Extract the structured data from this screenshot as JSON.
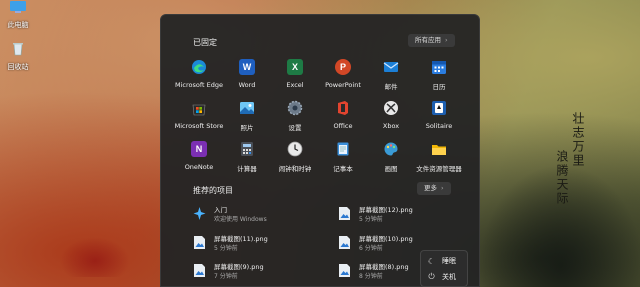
{
  "desktop": {
    "icons": [
      {
        "label": "此电脑",
        "icon": "computer-icon"
      },
      {
        "label": "回收站",
        "icon": "recycle-bin-icon"
      }
    ]
  },
  "wallpaper": {
    "poem_columns": [
      "壮",
      "志",
      "万",
      "里",
      "浪",
      "腾",
      "天",
      "际"
    ]
  },
  "start": {
    "pinned_title": "已固定",
    "all_apps_label": "所有应用",
    "pinned_apps": [
      {
        "label": "Microsoft Edge",
        "icon": "edge-icon"
      },
      {
        "label": "Word",
        "icon": "word-icon"
      },
      {
        "label": "Excel",
        "icon": "excel-icon"
      },
      {
        "label": "PowerPoint",
        "icon": "powerpoint-icon"
      },
      {
        "label": "邮件",
        "icon": "mail-icon"
      },
      {
        "label": "日历",
        "icon": "calendar-icon"
      },
      {
        "label": "Microsoft Store",
        "icon": "store-icon"
      },
      {
        "label": "照片",
        "icon": "photos-icon"
      },
      {
        "label": "设置",
        "icon": "settings-icon"
      },
      {
        "label": "Office",
        "icon": "office-icon"
      },
      {
        "label": "Xbox",
        "icon": "xbox-icon"
      },
      {
        "label": "Solitaire",
        "icon": "solitaire-icon"
      },
      {
        "label": "OneNote",
        "icon": "onenote-icon"
      },
      {
        "label": "计算器",
        "icon": "calculator-icon"
      },
      {
        "label": "闹钟和时钟",
        "icon": "clock-icon"
      },
      {
        "label": "记事本",
        "icon": "notepad-icon"
      },
      {
        "label": "画图",
        "icon": "paint-icon"
      },
      {
        "label": "文件资源管理器",
        "icon": "file-explorer-icon"
      }
    ],
    "recommended_title": "推荐的项目",
    "more_label": "更多",
    "recommended": [
      {
        "title": "入门",
        "subtitle": "欢迎使用 Windows",
        "icon": "get-started-icon"
      },
      {
        "title": "屏幕截图(12).png",
        "subtitle": "5 分钟前",
        "icon": "image-file-icon"
      },
      {
        "title": "屏幕截图(11).png",
        "subtitle": "5 分钟前",
        "icon": "image-file-icon"
      },
      {
        "title": "屏幕截图(10).png",
        "subtitle": "6 分钟前",
        "icon": "image-file-icon"
      },
      {
        "title": "屏幕截图(9).png",
        "subtitle": "7 分钟前",
        "icon": "image-file-icon"
      },
      {
        "title": "屏幕截图(8).png",
        "subtitle": "8 分钟前",
        "icon": "image-file-icon"
      }
    ]
  },
  "power_menu": {
    "items": [
      {
        "label": "睡眠",
        "icon": "moon-icon"
      },
      {
        "label": "关机",
        "icon": "power-icon"
      }
    ]
  }
}
